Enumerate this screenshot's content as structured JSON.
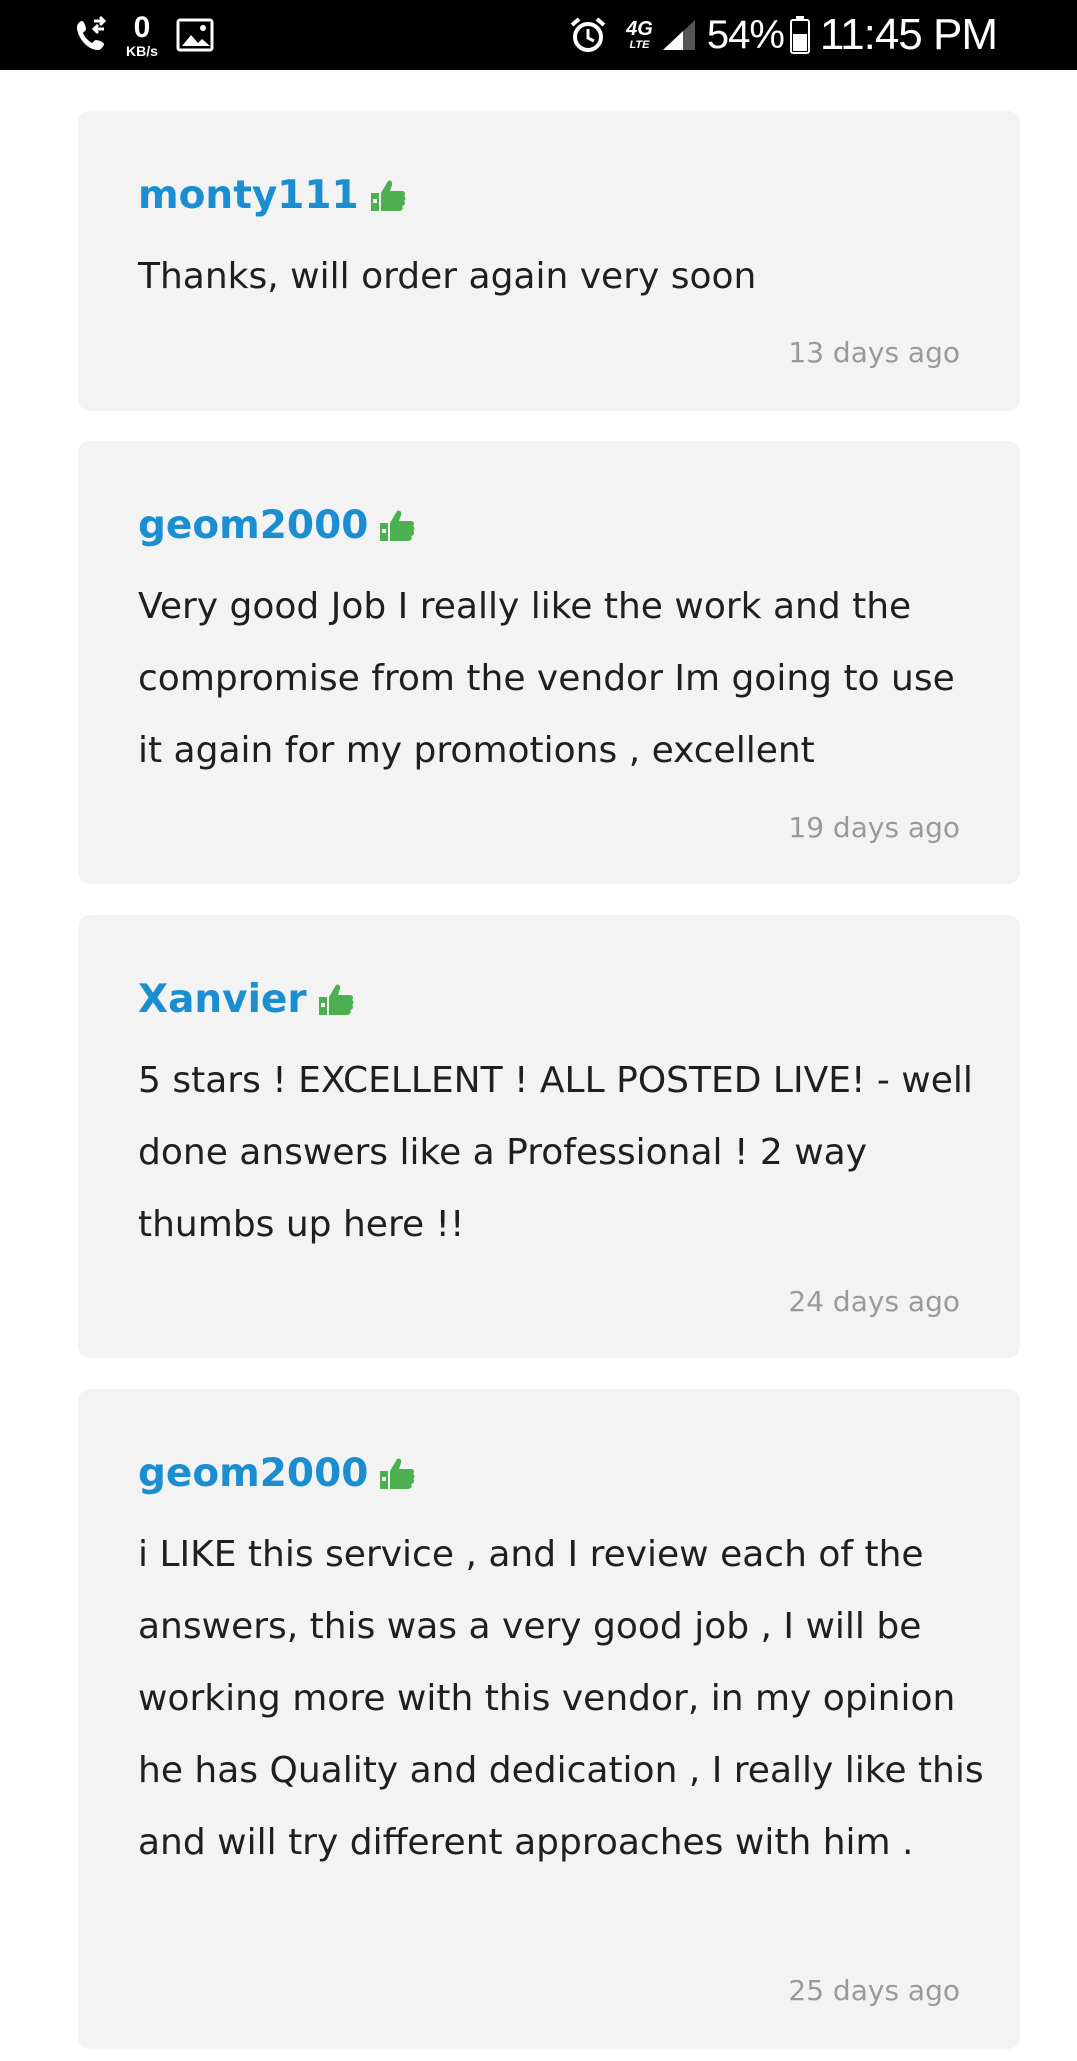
{
  "status_bar": {
    "speed_value": "0",
    "speed_unit": "KB/s",
    "network_top": "4G",
    "network_bottom": "LTE",
    "battery": "54%",
    "time": "11:45 PM",
    "icons": [
      "call-forward-icon",
      "image-icon",
      "alarm-icon",
      "signal-icon",
      "battery-icon"
    ]
  },
  "accent_colors": {
    "username": "#1a8ed1",
    "thumbs_up": "#4caf50",
    "card_bg": "#f3f3f3",
    "timestamp": "#9a9a9a"
  },
  "reviews": [
    {
      "username": "monty111",
      "badge_icon": "thumbs-up-icon",
      "text": "Thanks, will order again very soon",
      "time_ago": "13 days ago"
    },
    {
      "username": "geom2000",
      "badge_icon": "thumbs-up-icon",
      "text": "Very good Job I really like the work and the compromise from the vendor Im going to use it again for my promotions , excellent",
      "time_ago": "19 days ago"
    },
    {
      "username": "Xanvier",
      "badge_icon": "thumbs-up-icon",
      "text": "5 stars ! EXCELLENT ! ALL POSTED LIVE! - well done answers like a Professional ! 2 way thumbs up here !!",
      "time_ago": "24 days ago"
    },
    {
      "username": "geom2000",
      "badge_icon": "thumbs-up-icon",
      "text": "i LIKE this service , and I review each of the answers, this was a very good job , I will be working more with this vendor, in my opinion he has Quality and dedication , I really like this and will try different approaches with him .",
      "time_ago": "25 days ago"
    }
  ]
}
